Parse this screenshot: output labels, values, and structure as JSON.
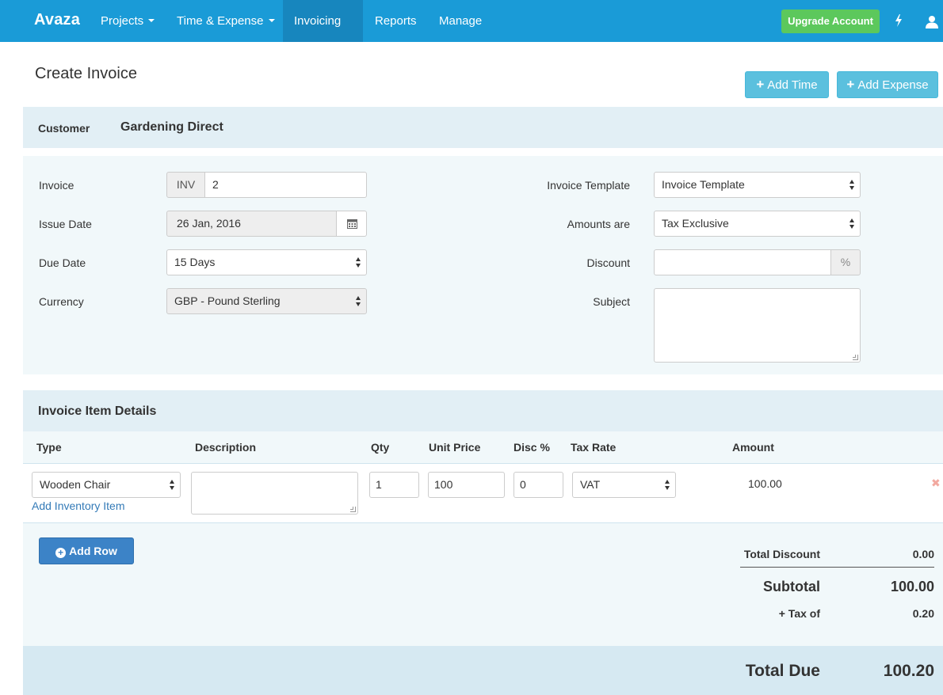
{
  "nav": {
    "brand": "Avaza",
    "items": [
      {
        "label": "Projects",
        "dropdown": true
      },
      {
        "label": "Time & Expense",
        "dropdown": true
      },
      {
        "label": "Invoicing",
        "dropdown": true
      },
      {
        "label": "Reports",
        "dropdown": false
      },
      {
        "label": "Manage",
        "dropdown": false
      }
    ],
    "upgrade_label": "Upgrade Account",
    "icons": [
      "lightning-icon",
      "user-icon"
    ]
  },
  "page": {
    "title": "Create Invoice",
    "add_time_label": "Add Time",
    "add_expense_label": "Add Expense"
  },
  "customer": {
    "label": "Customer",
    "value": "Gardening Direct"
  },
  "form": {
    "invoice_label": "Invoice",
    "invoice_prefix": "INV",
    "invoice_number": "2",
    "issue_date_label": "Issue Date",
    "issue_date": "26 Jan, 2016",
    "due_date_label": "Due Date",
    "due_date": "15 Days",
    "currency_label": "Currency",
    "currency": "GBP - Pound Sterling",
    "template_label": "Invoice Template",
    "template": "Invoice Template",
    "amounts_label": "Amounts are",
    "amounts": "Tax Exclusive",
    "discount_label": "Discount",
    "discount_value": "",
    "discount_unit": "%",
    "subject_label": "Subject",
    "subject_value": ""
  },
  "items": {
    "title": "Invoice Item Details",
    "columns": {
      "type": "Type",
      "description": "Description",
      "qty": "Qty",
      "unit_price": "Unit Price",
      "disc": "Disc %",
      "tax_rate": "Tax Rate",
      "amount": "Amount"
    },
    "rows": [
      {
        "type": "Wooden Chair",
        "description": "",
        "qty": "1",
        "unit_price": "100",
        "disc": "0",
        "tax_rate": "VAT",
        "amount": "100.00"
      }
    ],
    "add_inventory_label": "Add Inventory Item",
    "remove_symbol": "✖",
    "add_row_label": "Add Row"
  },
  "totals": {
    "discount_label": "Total Discount",
    "discount_value": "0.00",
    "subtotal_label": "Subtotal",
    "subtotal_value": "100.00",
    "tax_label": "+ Tax of",
    "tax_value": "0.20",
    "due_label": "Total Due",
    "due_value": "100.20"
  },
  "colors": {
    "nav": "#1a9bd7",
    "nav_active": "#1786be",
    "upgrade": "#5cc85c",
    "info_button": "#5bc0de",
    "primary_button": "#3c83c7",
    "panel": "#f1f8fa",
    "header_panel": "#e2eff5",
    "total_bar": "#d6e9f2",
    "link": "#337ab7"
  }
}
